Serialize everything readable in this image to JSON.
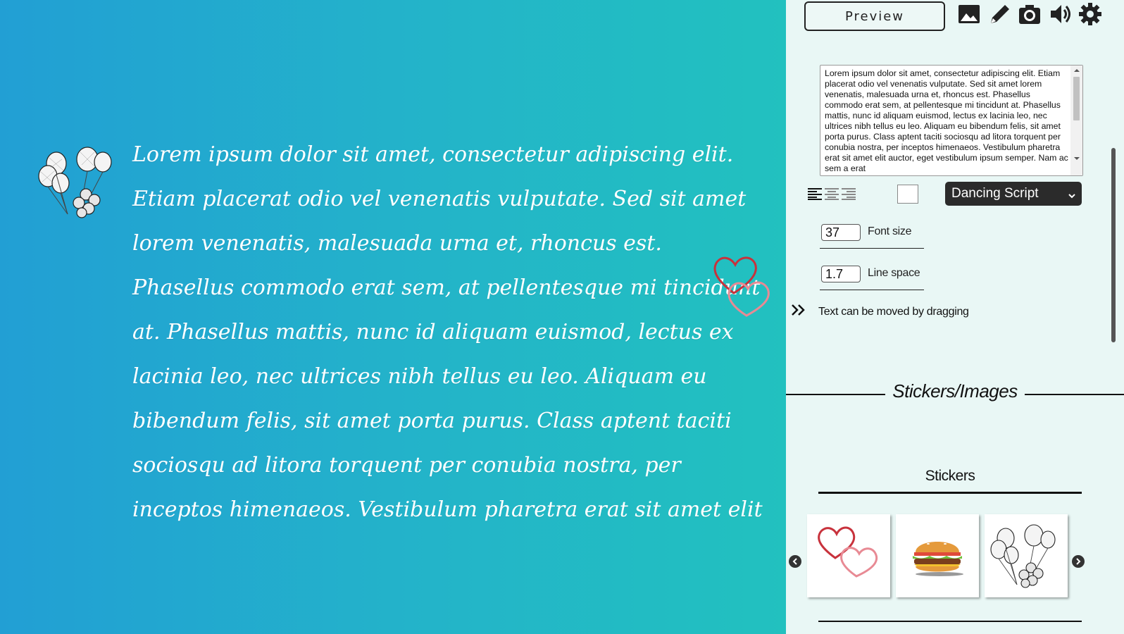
{
  "canvas": {
    "text_lines": [
      "Lorem ipsum dolor sit amet, consectetur adipiscing elit.",
      "Etiam placerat odio vel venenatis vulputate. Sed sit amet",
      "lorem venenatis, malesuada urna et, rhoncus est.",
      "Phasellus commodo erat sem, at pellentesque mi tincidunt",
      "at. Phasellus mattis, nunc id aliquam euismod, lectus ex",
      "lacinia leo, nec ultrices nibh tellus eu leo. Aliquam eu",
      "bibendum felis, sit amet porta purus. Class aptent taciti",
      "sociosqu ad litora torquent per conubia nostra, per",
      "inceptos himenaeos. Vestibulum pharetra erat sit amet elit"
    ],
    "stickers": [
      "balloons-icon",
      "hearts-icon"
    ],
    "colors": {
      "gradient_start": "#229fd4",
      "gradient_end": "#22c1bf",
      "text": "#ffffff"
    }
  },
  "toolbar": {
    "preview_label": "Preview",
    "icons": [
      "image-icon",
      "pencil-icon",
      "camera-icon",
      "speaker-icon",
      "gear-icon"
    ]
  },
  "editor": {
    "text_value": "Lorem ipsum dolor sit amet, consectetur adipiscing elit. Etiam placerat odio vel venenatis vulputate. Sed sit amet lorem venenatis, malesuada urna et, rhoncus est. Phasellus commodo erat sem, at pellentesque mi tincidunt at. Phasellus mattis, nunc id aliquam euismod, lectus ex lacinia leo, nec ultrices nibh tellus eu leo. Aliquam eu bibendum felis, sit amet porta purus. Class aptent taciti sociosqu ad litora torquent per conubia nostra, per inceptos himenaeos. Vestibulum pharetra erat sit amet elit auctor, eget vestibulum ipsum semper. Nam ac sem a erat",
    "alignment_options": [
      "align-left-icon",
      "align-center-icon",
      "align-right-icon"
    ],
    "text_color": "#ffffff",
    "font_family_selected": "Dancing Script",
    "font_size_value": "37",
    "font_size_label": "Font size",
    "line_space_value": "1.7",
    "line_space_label": "Line space",
    "drag_hint": "Text can be moved by dragging"
  },
  "section": {
    "heading": "Stickers/Images",
    "tab_label": "Stickers",
    "stickers": [
      "hearts-sticker",
      "burger-sticker",
      "balloons-sticker"
    ]
  }
}
